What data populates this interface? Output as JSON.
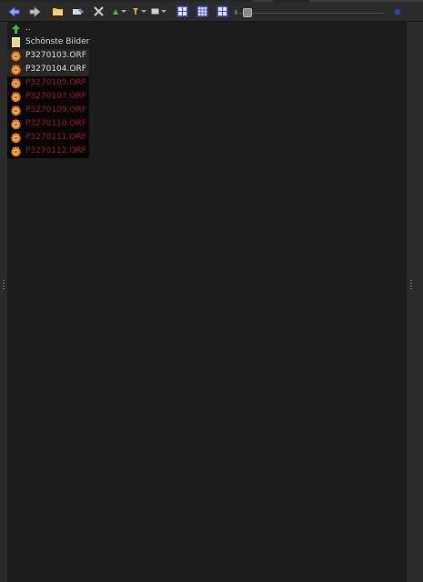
{
  "toolbar": {
    "buttons": [
      "back-icon",
      "forward-icon",
      "open-folder-icon",
      "clear-icon",
      "close-icon",
      "rating-filter-icon",
      "color-filter-icon",
      "view-mode-icon",
      "thumbnail-large-icon",
      "thumbnail-grid-icon",
      "thumbnail-small-icon"
    ],
    "accent": "#3f51d8",
    "zoom_level": 0.03
  },
  "file_list": {
    "parent_label": "..",
    "folder_label": "Schönste Bilder",
    "files": [
      {
        "name": "P3270103.ORF",
        "style": "selected"
      },
      {
        "name": "P3270104.ORF",
        "style": "selected"
      },
      {
        "name": "P3270105.ORF",
        "style": "dark"
      },
      {
        "name": "P3270107.ORF",
        "style": "dark"
      },
      {
        "name": "P3270109.ORF",
        "style": "dark"
      },
      {
        "name": "P3270110.ORF",
        "style": "dark"
      },
      {
        "name": "P3270111.ORF",
        "style": "dark"
      },
      {
        "name": "P3270112.ORF",
        "style": "dark"
      }
    ],
    "colors": {
      "folder": "#e7d68c",
      "up_arrow": "#3fb83f",
      "file_icon": "#e8731c",
      "dark_text": "#a11c1c"
    }
  }
}
